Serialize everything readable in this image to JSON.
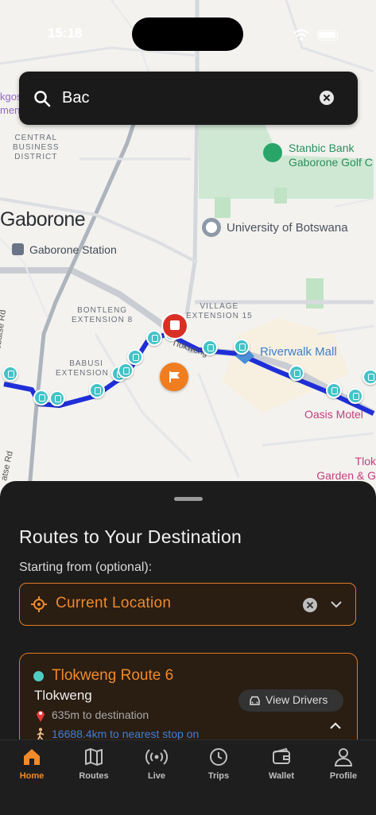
{
  "status_bar": {
    "time": "15:18"
  },
  "search": {
    "query": "Bac"
  },
  "map": {
    "labels": {
      "cbd": "CENTRAL\nBUSINESS\nDISTRICT",
      "city": "Gaborone",
      "station": "Gaborone Station",
      "university": "University of Botswana",
      "stanbic_line1": "Stanbic Bank",
      "stanbic_line2": "Gaborone Golf C",
      "bontleng": "BONTLENG\nEXTENSION 8",
      "village": "VILLAGE\nEXTENSION 15",
      "babusi": "BABUSI\nEXTENSION 4",
      "riverwalk": "Riverwalk Mall",
      "oasis": "Oasis Motel",
      "tlok_line1": "Tlok",
      "tlok_line2": "Garden & G",
      "old_lobatse": "Old Lobatse Rd",
      "lobatse_rd": "atse Rd",
      "tlokweng_rd": "Tlokweng",
      "kgos_line1": "kgos",
      "kgos_line2": "men"
    },
    "route_color": "#1f2fd8",
    "stop_color": "#43c3c8"
  },
  "sheet": {
    "title": "Routes to Your Destination",
    "starting_label": "Starting from (optional):",
    "location_value": "Current Location",
    "accent_color": "#f08a2a",
    "routes": [
      {
        "name": "Tlokweng Route 6",
        "area": "Tlokweng",
        "distance": "635m to destination",
        "walk": "16688.4km to nearest stop on",
        "button": "View Drivers",
        "dot_color": "#4ecdc4"
      }
    ]
  },
  "tabs": [
    {
      "label": "Home",
      "icon": "home-icon",
      "active": true
    },
    {
      "label": "Routes",
      "icon": "map-icon",
      "active": false
    },
    {
      "label": "Live",
      "icon": "broadcast-icon",
      "active": false
    },
    {
      "label": "Trips",
      "icon": "clock-icon",
      "active": false
    },
    {
      "label": "Wallet",
      "icon": "wallet-icon",
      "active": false
    },
    {
      "label": "Profile",
      "icon": "person-icon",
      "active": false
    }
  ]
}
